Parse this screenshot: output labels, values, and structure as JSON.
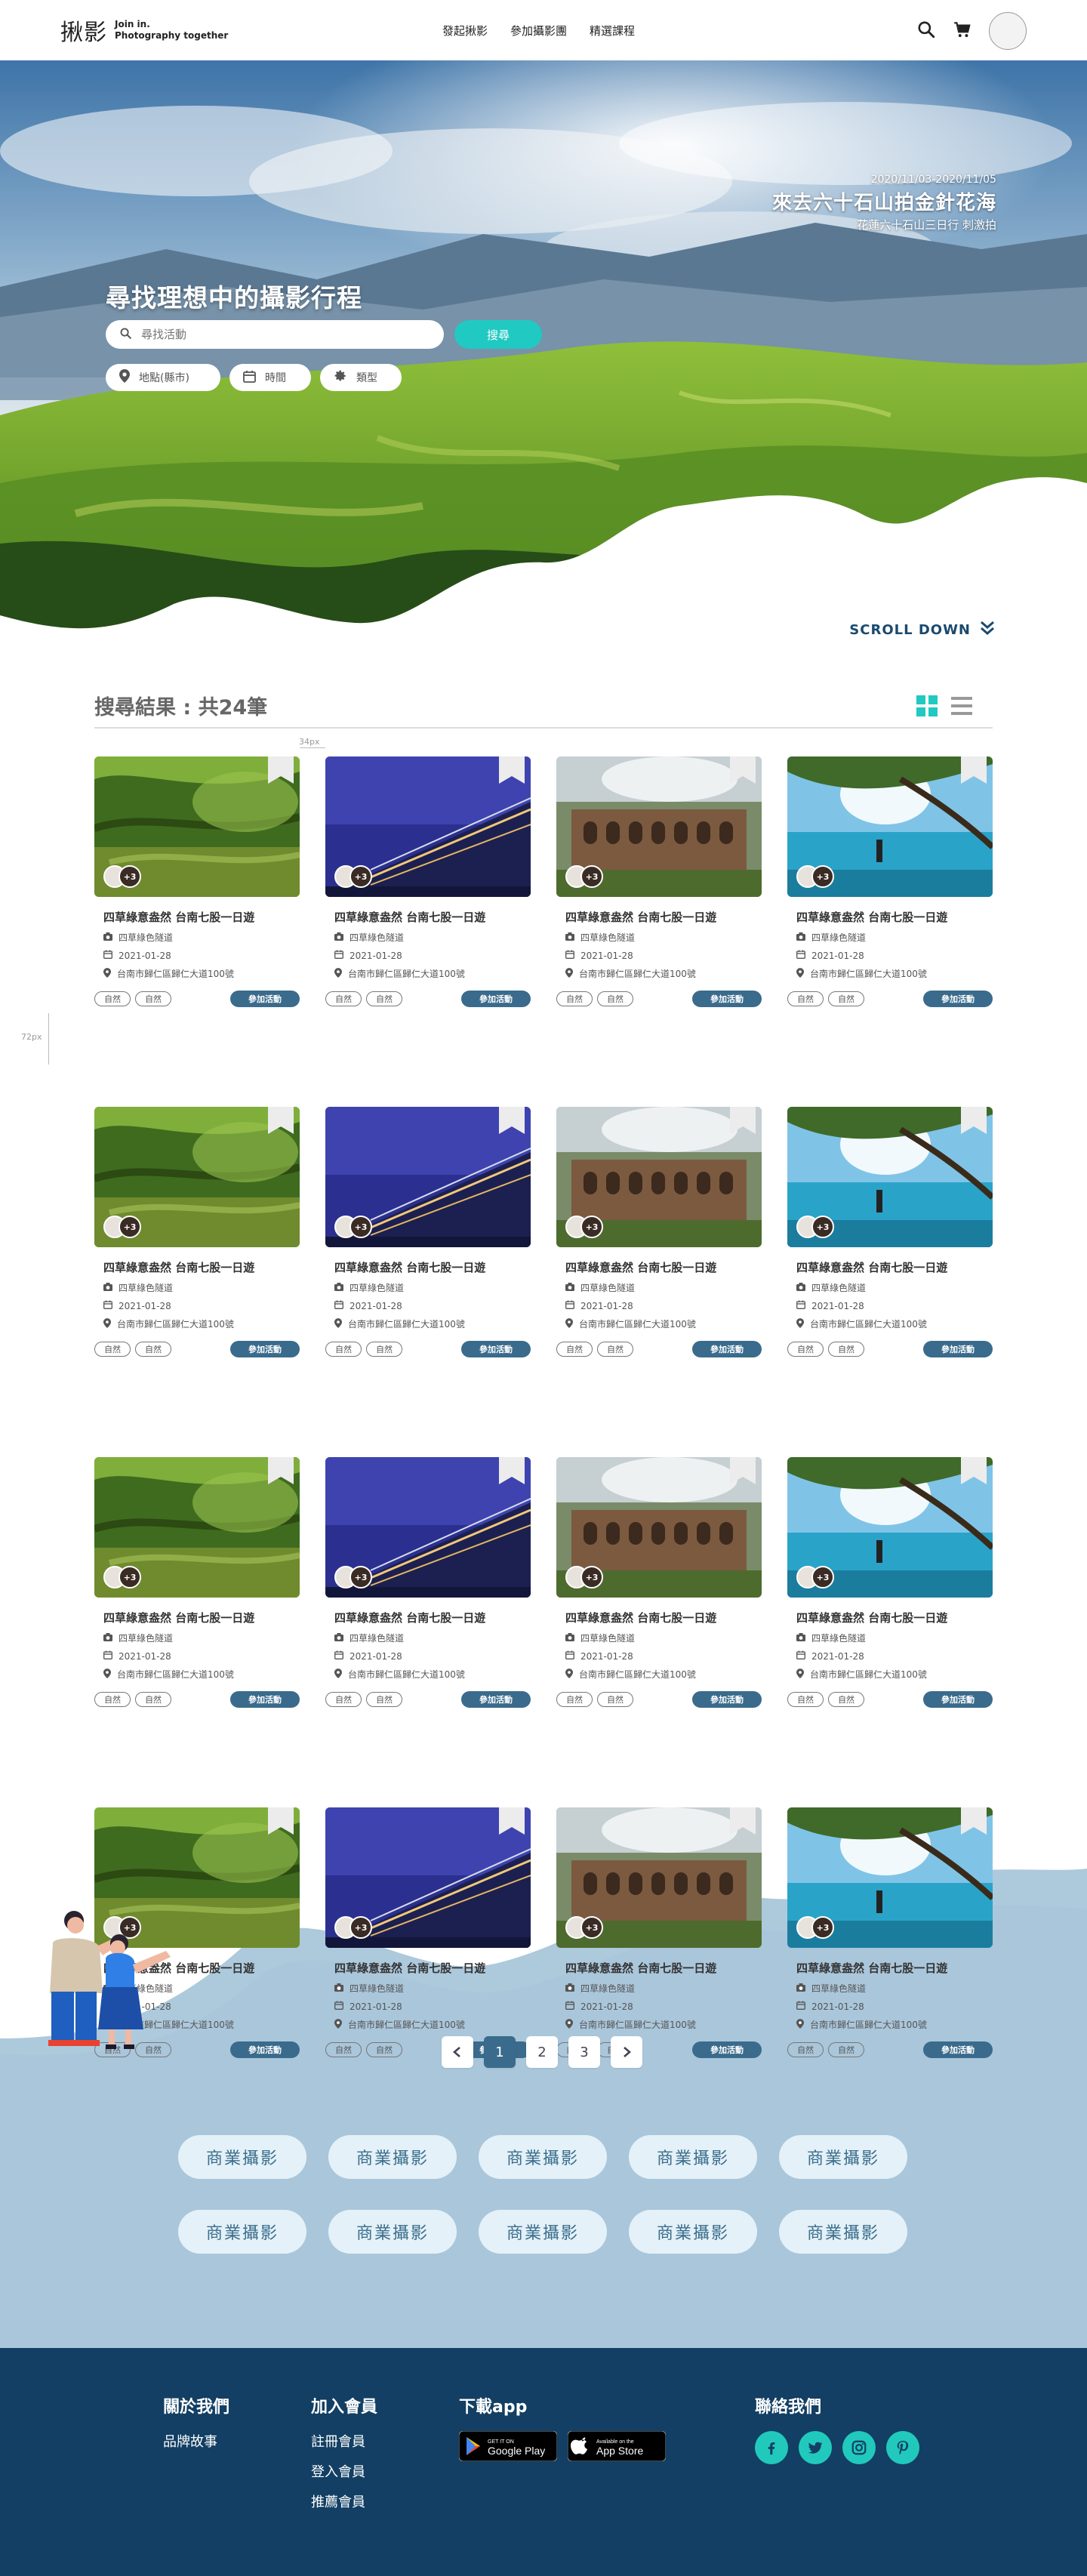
{
  "header": {
    "logo_mark": "揪影",
    "slogan_line1": "Join in.",
    "slogan_line2": "Photography together",
    "nav": [
      "發起揪影",
      "參加攝影團",
      "精選課程"
    ]
  },
  "hero": {
    "event_date": "2020/11/03-2020/11/05",
    "event_title": "來去六十石山拍金針花海",
    "event_sub": "花蓮六十石山三日行 刺激拍",
    "search_title": "尋找理想中的攝影行程",
    "search_placeholder": "尋找活動",
    "search_button": "搜尋",
    "filters": {
      "location": "地點(縣市)",
      "time": "時間",
      "type": "類型"
    },
    "scroll_down": "SCROLL DOWN"
  },
  "results": {
    "title": "搜尋結果 : 共24筆",
    "guide_gap": "34px",
    "guide_side": "72px"
  },
  "cards": [
    {
      "photo": "river-tree",
      "attendees": "+3",
      "title": "四草綠意盎然 台南七股一日遊",
      "category": "四草綠色隧道",
      "date": "2021-01-28",
      "address": "台南市歸仁區歸仁大道100號",
      "tags": [
        "自然",
        "自然"
      ],
      "join": "參加活動"
    },
    {
      "photo": "night-building",
      "attendees": "+3",
      "title": "四草綠意盎然 台南七股一日遊",
      "category": "四草綠色隧道",
      "date": "2021-01-28",
      "address": "台南市歸仁區歸仁大道100號",
      "tags": [
        "自然",
        "自然"
      ],
      "join": "參加活動"
    },
    {
      "photo": "arch-ruins",
      "attendees": "+3",
      "title": "四草綠意盎然 台南七股一日遊",
      "category": "四草綠色隧道",
      "date": "2021-01-28",
      "address": "台南市歸仁區歸仁大道100號",
      "tags": [
        "自然",
        "自然"
      ],
      "join": "參加活動"
    },
    {
      "photo": "lake-tree",
      "attendees": "+3",
      "title": "四草綠意盎然 台南七股一日遊",
      "category": "四草綠色隧道",
      "date": "2021-01-28",
      "address": "台南市歸仁區歸仁大道100號",
      "tags": [
        "自然",
        "自然"
      ],
      "join": "參加活動"
    },
    {
      "photo": "river-tree",
      "attendees": "+3",
      "title": "四草綠意盎然 台南七股一日遊",
      "category": "四草綠色隧道",
      "date": "2021-01-28",
      "address": "台南市歸仁區歸仁大道100號",
      "tags": [
        "自然",
        "自然"
      ],
      "join": "參加活動"
    },
    {
      "photo": "night-building",
      "attendees": "+3",
      "title": "四草綠意盎然 台南七股一日遊",
      "category": "四草綠色隧道",
      "date": "2021-01-28",
      "address": "台南市歸仁區歸仁大道100號",
      "tags": [
        "自然",
        "自然"
      ],
      "join": "參加活動"
    },
    {
      "photo": "arch-ruins",
      "attendees": "+3",
      "title": "四草綠意盎然 台南七股一日遊",
      "category": "四草綠色隧道",
      "date": "2021-01-28",
      "address": "台南市歸仁區歸仁大道100號",
      "tags": [
        "自然",
        "自然"
      ],
      "join": "參加活動"
    },
    {
      "photo": "lake-tree",
      "attendees": "+3",
      "title": "四草綠意盎然 台南七股一日遊",
      "category": "四草綠色隧道",
      "date": "2021-01-28",
      "address": "台南市歸仁區歸仁大道100號",
      "tags": [
        "自然",
        "自然"
      ],
      "join": "參加活動"
    },
    {
      "photo": "river-tree",
      "attendees": "+3",
      "title": "四草綠意盎然 台南七股一日遊",
      "category": "四草綠色隧道",
      "date": "2021-01-28",
      "address": "台南市歸仁區歸仁大道100號",
      "tags": [
        "自然",
        "自然"
      ],
      "join": "參加活動"
    },
    {
      "photo": "night-building",
      "attendees": "+3",
      "title": "四草綠意盎然 台南七股一日遊",
      "category": "四草綠色隧道",
      "date": "2021-01-28",
      "address": "台南市歸仁區歸仁大道100號",
      "tags": [
        "自然",
        "自然"
      ],
      "join": "參加活動"
    },
    {
      "photo": "arch-ruins",
      "attendees": "+3",
      "title": "四草綠意盎然 台南七股一日遊",
      "category": "四草綠色隧道",
      "date": "2021-01-28",
      "address": "台南市歸仁區歸仁大道100號",
      "tags": [
        "自然",
        "自然"
      ],
      "join": "參加活動"
    },
    {
      "photo": "lake-tree",
      "attendees": "+3",
      "title": "四草綠意盎然 台南七股一日遊",
      "category": "四草綠色隧道",
      "date": "2021-01-28",
      "address": "台南市歸仁區歸仁大道100號",
      "tags": [
        "自然",
        "自然"
      ],
      "join": "參加活動"
    },
    {
      "photo": "river-tree",
      "attendees": "+3",
      "title": "四草綠意盎然 台南七股一日遊",
      "category": "四草綠色隧道",
      "date": "2021-01-28",
      "address": "台南市歸仁區歸仁大道100號",
      "tags": [
        "自然",
        "自然"
      ],
      "join": "參加活動"
    },
    {
      "photo": "night-building",
      "attendees": "+3",
      "title": "四草綠意盎然 台南七股一日遊",
      "category": "四草綠色隧道",
      "date": "2021-01-28",
      "address": "台南市歸仁區歸仁大道100號",
      "tags": [
        "自然",
        "自然"
      ],
      "join": "參加活動"
    },
    {
      "photo": "arch-ruins",
      "attendees": "+3",
      "title": "四草綠意盎然 台南七股一日遊",
      "category": "四草綠色隧道",
      "date": "2021-01-28",
      "address": "台南市歸仁區歸仁大道100號",
      "tags": [
        "自然",
        "自然"
      ],
      "join": "參加活動"
    },
    {
      "photo": "lake-tree",
      "attendees": "+3",
      "title": "四草綠意盎然 台南七股一日遊",
      "category": "四草綠色隧道",
      "date": "2021-01-28",
      "address": "台南市歸仁區歸仁大道100號",
      "tags": [
        "自然",
        "自然"
      ],
      "join": "參加活動"
    }
  ],
  "pagination": {
    "prev_icon": "chevron-left-icon",
    "pages": [
      "1",
      "2",
      "3"
    ],
    "current": "1",
    "next_icon": "chevron-right-icon"
  },
  "category_tags": [
    "商業攝影",
    "商業攝影",
    "商業攝影",
    "商業攝影",
    "商業攝影",
    "商業攝影",
    "商業攝影",
    "商業攝影",
    "商業攝影",
    "商業攝影"
  ],
  "footer": {
    "about": {
      "heading": "關於我們",
      "links": [
        "品牌故事"
      ]
    },
    "member": {
      "heading": "加入會員",
      "links": [
        "註冊會員",
        "登入會員",
        "推薦會員"
      ]
    },
    "app": {
      "heading": "下載app",
      "google_small": "GET IT ON",
      "google_big": "Google Play",
      "apple_small": "Available on the",
      "apple_big": "App Store"
    },
    "contact": {
      "heading": "聯絡我們",
      "icons": [
        "facebook-icon",
        "twitter-icon",
        "instagram-icon",
        "pinterest-icon"
      ]
    }
  },
  "colors": {
    "teal": "#20c9c1",
    "navy": "#123f63",
    "steel_blue": "#3a6b8c",
    "wave_blue": "#adc9dc",
    "tag_bg": "#e4f1f8"
  }
}
